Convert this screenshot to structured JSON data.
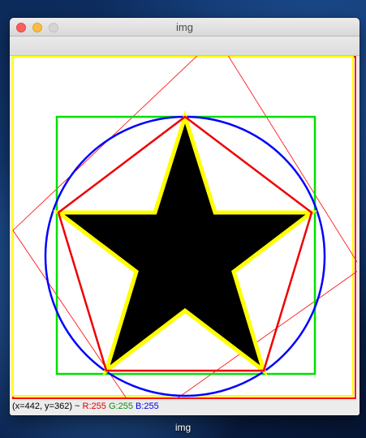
{
  "window": {
    "title": "img",
    "controls": {
      "close": "close-icon",
      "minimize": "minimize-icon",
      "zoom": "zoom-icon"
    }
  },
  "status": {
    "coords": "(x=442, y=362) ~",
    "r": "R:255",
    "g": "G:255",
    "b": "B:255"
  },
  "dock": {
    "label": "img"
  },
  "colors": {
    "border_yellow": "#ffff00",
    "border_red": "#ff0000",
    "bounding_box_green": "#00e000",
    "circle_blue": "#0000ff",
    "pentagon_red": "#ee0000",
    "star_outline_yellow": "#ffff00",
    "star_fill": "#000000",
    "rotated_rect_red": "#ff0000"
  }
}
